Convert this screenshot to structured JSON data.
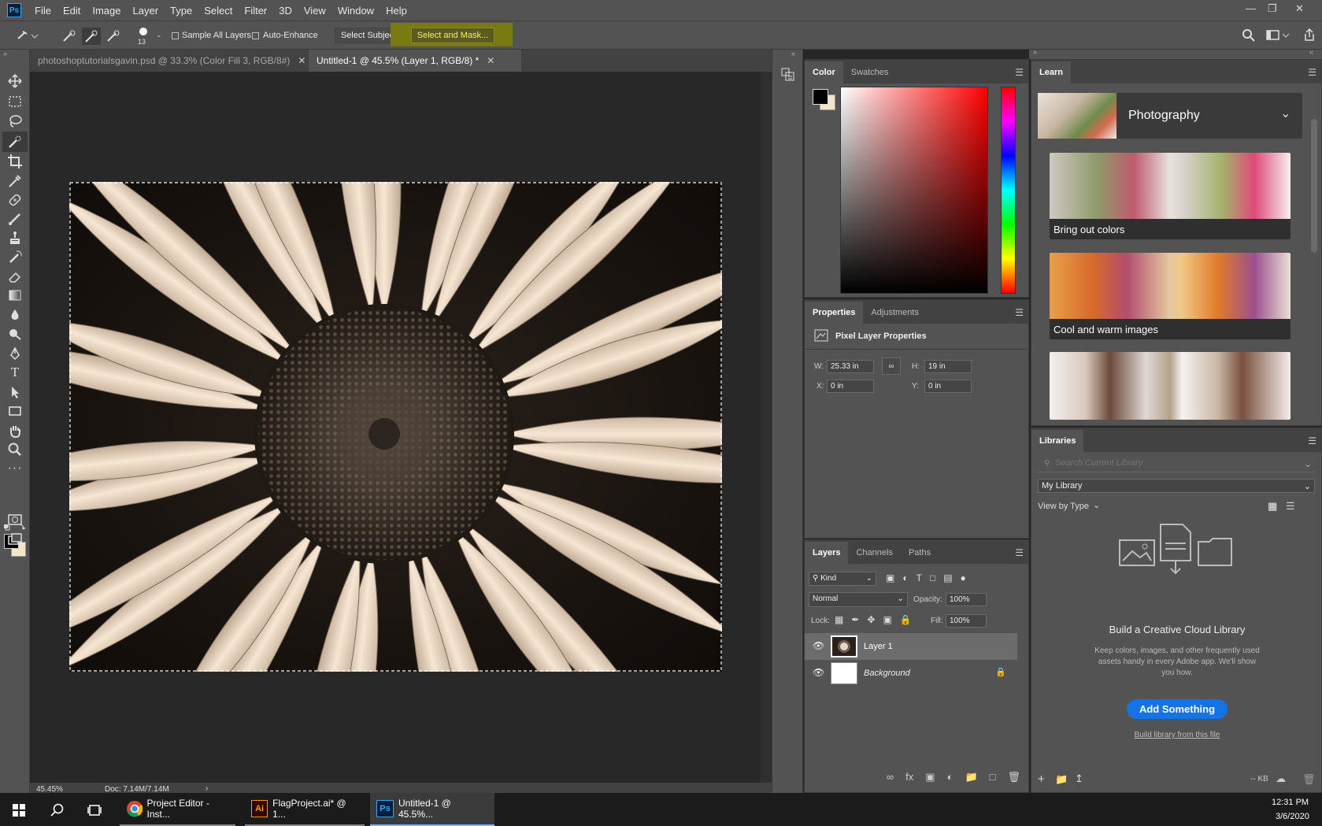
{
  "menubar": {
    "logo": "Ps",
    "items": [
      "File",
      "Edit",
      "Image",
      "Layer",
      "Type",
      "Select",
      "Filter",
      "3D",
      "View",
      "Window",
      "Help"
    ]
  },
  "options": {
    "brush_size": "13",
    "sample_all_layers": "Sample All Layers",
    "auto_enhance": "Auto-Enhance",
    "select_subject": "Select Subject",
    "select_and_mask": "Select and Mask..."
  },
  "tabs": [
    {
      "label": "photoshoptutorialsgavin.psd @ 33.3% (Color Fill 3, RGB/8#)"
    },
    {
      "label": "Untitled-1 @ 45.5% (Layer 1, RGB/8) *"
    }
  ],
  "status": {
    "zoom": "45.45%",
    "doc": "Doc: 7.14M/7.14M"
  },
  "color_panel": {
    "tabs": [
      "Color",
      "Swatches"
    ],
    "fg": "#000000",
    "bg": "#f3e6c8"
  },
  "properties": {
    "tabs": [
      "Properties",
      "Adjustments"
    ],
    "title": "Pixel Layer Properties",
    "w_label": "W:",
    "w": "25.33 in",
    "h_label": "H:",
    "h": "19 in",
    "x_label": "X:",
    "x": "0 in",
    "y_label": "Y:",
    "y": "0 in"
  },
  "layers_panel": {
    "tabs": [
      "Layers",
      "Channels",
      "Paths"
    ],
    "kind": "Kind",
    "blend": "Normal",
    "opacity_label": "Opacity:",
    "opacity": "100%",
    "lock_label": "Lock:",
    "fill_label": "Fill:",
    "fill": "100%",
    "layers": [
      {
        "name": "Layer 1"
      },
      {
        "name": "Background"
      }
    ]
  },
  "learn": {
    "tab": "Learn",
    "category": "Photography",
    "cards": [
      {
        "label": "Bring out colors"
      },
      {
        "label": "Cool and warm images"
      },
      {
        "label": ""
      }
    ]
  },
  "libraries": {
    "tab": "Libraries",
    "search_placeholder": "Search Current Library",
    "library": "My Library",
    "view_by": "View by Type",
    "heading": "Build a Creative Cloud Library",
    "body": "Keep colors, images, and other frequently used assets handy in every Adobe app. We'll show you how.",
    "button": "Add Something",
    "link": "Build library from this file",
    "size": "-- KB"
  },
  "taskbar": {
    "apps": [
      {
        "label": "Project Editor - Inst..."
      },
      {
        "label": "FlagProject.ai* @ 1..."
      },
      {
        "label": "Untitled-1 @ 45.5%..."
      }
    ],
    "time": "12:31 PM",
    "date": "3/6/2020"
  }
}
